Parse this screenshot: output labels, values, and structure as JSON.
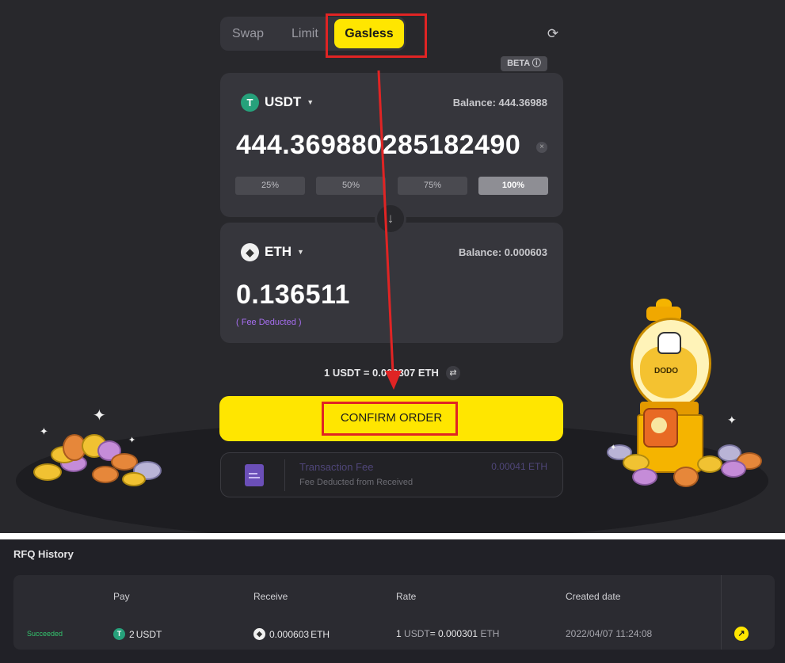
{
  "tabs": {
    "swap": "Swap",
    "limit": "Limit",
    "gasless": "Gasless",
    "active": "gasless"
  },
  "beta_label": "BETA ⓘ",
  "from": {
    "token": "USDT",
    "balance": "Balance: 444.36988",
    "amount": "444.369880285182490",
    "percent_buttons": [
      "25%",
      "50%",
      "75%",
      "100%"
    ],
    "selected_percent": "100%"
  },
  "to": {
    "token": "ETH",
    "balance": "Balance: 0.000603",
    "amount": "0.136511",
    "note": "( Fee Deducted )"
  },
  "rate_text": "1 USDT = 0.000307 ETH",
  "confirm_label": "CONFIRM ORDER",
  "fee": {
    "title": "Transaction Fee",
    "value": "0.00041 ETH",
    "subtitle": "Fee Deducted from Received"
  },
  "mascot_label": "DODO",
  "colors": {
    "accent_yellow": "#ffe600",
    "background": "#28282c",
    "card": "#36363c",
    "annotation_red": "#e02424",
    "success_green": "#34c56e",
    "fee_purple": "#a66ef0"
  },
  "history": {
    "title": "RFQ History",
    "columns": [
      "Pay",
      "Receive",
      "Rate",
      "Created date"
    ],
    "rows": [
      {
        "status": "Succeeded",
        "pay_amount": "2",
        "pay_token": "USDT",
        "receive_amount": "0.000603",
        "receive_token": "ETH",
        "rate_left": "1",
        "rate_left_token": "USDT",
        "rate_eq": " = 0.000301",
        "rate_right_token": "ETH",
        "created": "2022/04/07 11:24:08"
      }
    ]
  }
}
